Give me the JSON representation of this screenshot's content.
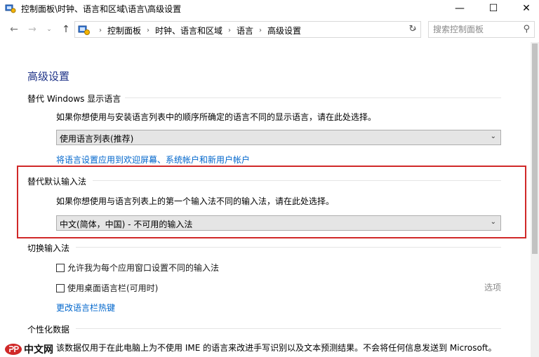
{
  "window": {
    "title": "控制面板\\时钟、语言和区域\\语言\\高级设置",
    "minimize_glyph": "—",
    "maximize_glyph": "☐",
    "close_glyph": "✕"
  },
  "nav": {
    "back_glyph": "←",
    "forward_glyph": "→",
    "recent_glyph": "⌄",
    "up_glyph": "↑",
    "refresh_glyph": "↻"
  },
  "address": {
    "crumbs": [
      "控制面板",
      "时钟、语言和区域",
      "语言",
      "高级设置"
    ],
    "separator": "›",
    "dropdown_glyph": "⌄"
  },
  "search": {
    "placeholder": "搜索控制面板",
    "icon": "search-icon",
    "icon_glyph": "⚲"
  },
  "main": {
    "page_title": "高级设置",
    "display_lang": {
      "heading": "替代 Windows 显示语言",
      "description": "如果你想使用与安装语言列表中的顺序所确定的语言不同的显示语言，请在此处选择。",
      "selected": "使用语言列表(推荐)",
      "link": "将语言设置应用到欢迎屏幕、系统帐户和新用户帐户"
    },
    "default_input": {
      "heading": "替代默认输入法",
      "description": "如果你想使用与语言列表上的第一个输入法不同的输入法，请在此处选择。",
      "selected": "中文(简体，中国) - 不可用的输入法"
    },
    "switch_input": {
      "heading": "切换输入法",
      "checkbox1": "允许我为每个应用窗口设置不同的输入法",
      "checkbox2": "使用桌面语言栏(可用时)",
      "options_link": "选项",
      "hotkey_link": "更改语言栏热键"
    },
    "personalization": {
      "heading": "个性化数据",
      "text": "该数据仅用于在此电脑上为不使用 IME 的语言来改进手写识别以及文本预测结果。不会将任何信息发送到 Microsoft。"
    },
    "arrow_glyph": "⌄"
  },
  "watermark": {
    "text": "中文网",
    "logo": "php-logo"
  },
  "colors": {
    "title_blue": "#1e3287",
    "link_blue": "#0066cc",
    "highlight_red": "#d02828"
  }
}
